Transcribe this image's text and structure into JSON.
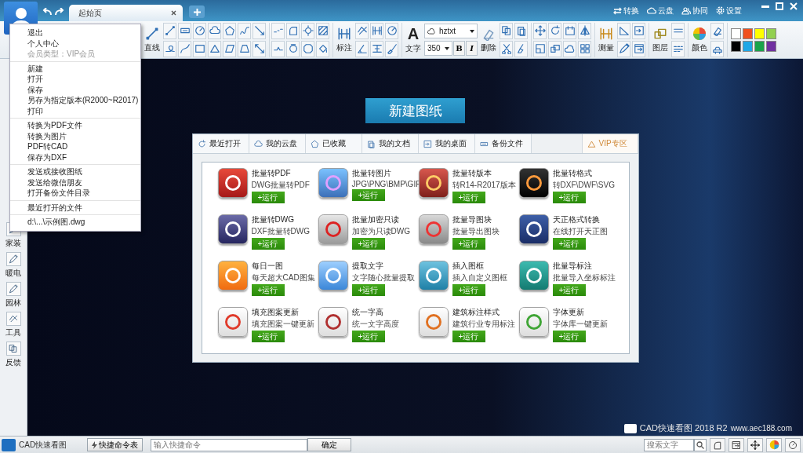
{
  "title_bar": {
    "tabs": [
      {
        "label": "起始页",
        "selected": true
      }
    ],
    "actions": [
      {
        "label": "转换"
      },
      {
        "label": "云盘"
      },
      {
        "label": "协同"
      },
      {
        "label": "设置"
      }
    ]
  },
  "toolbar": {
    "buttons": [
      {
        "label": "直线"
      },
      {
        "label": "标注"
      },
      {
        "label": "文字"
      },
      {
        "label": "删除"
      },
      {
        "label": "测量"
      },
      {
        "label": "图层"
      },
      {
        "label": "颜色"
      }
    ],
    "text_icon": "A",
    "font": {
      "value": "hztxt"
    },
    "size": {
      "value": "350"
    },
    "bold": "B",
    "italic": "I",
    "swatches": [
      {
        "color": "#ffffff"
      },
      {
        "color": "#f0501e"
      },
      {
        "color": "#ffff00"
      },
      {
        "color": "#92d050"
      },
      {
        "color": "#000000"
      },
      {
        "color": "#1fa8e6"
      },
      {
        "color": "#1aa34a"
      },
      {
        "color": "#7030a0"
      }
    ]
  },
  "user_menu": {
    "sections": [
      [
        {
          "label": "退出",
          "disabled": false
        },
        {
          "label": "个人中心",
          "disabled": false
        },
        {
          "label": "会员类型：VIP会员",
          "disabled": true
        }
      ],
      [
        {
          "label": "新建",
          "disabled": false
        },
        {
          "label": "打开",
          "disabled": false
        },
        {
          "label": "保存",
          "disabled": false
        },
        {
          "label": "另存为指定版本(R2000~R2017)",
          "disabled": false
        },
        {
          "label": "打印",
          "disabled": false
        }
      ],
      [
        {
          "label": "转换为PDF文件",
          "disabled": false
        },
        {
          "label": "转换为图片",
          "disabled": false
        },
        {
          "label": "PDF转CAD",
          "disabled": false
        },
        {
          "label": "保存为DXF",
          "disabled": false
        }
      ],
      [
        {
          "label": "发送或接收图纸",
          "disabled": false
        },
        {
          "label": "发送给微信朋友",
          "disabled": false
        },
        {
          "label": "打开备份文件目录",
          "disabled": false
        }
      ],
      [
        {
          "label": "最近打开的文件",
          "disabled": false
        }
      ],
      [
        {
          "label": "d:\\...\\示例图.dwg",
          "disabled": false
        }
      ]
    ]
  },
  "sidebar": {
    "items": [
      {
        "label": "家装"
      },
      {
        "label": "暖电"
      },
      {
        "label": "园林"
      },
      {
        "label": "工具"
      },
      {
        "label": "反馈"
      }
    ]
  },
  "canvas": {
    "new_drawing_button": "新建图纸",
    "tabs": [
      {
        "label": "最近打开",
        "selected": false
      },
      {
        "label": "我的云盘",
        "selected": false
      },
      {
        "label": "已收藏",
        "selected": false
      },
      {
        "label": "我的文档",
        "selected": false
      },
      {
        "label": "我的桌面",
        "selected": false
      },
      {
        "label": "备份文件",
        "selected": false
      },
      {
        "label": "VIP专区",
        "selected": true
      }
    ],
    "apps": [
      {
        "title": "批量转PDF",
        "subtitle": "DWG批量转PDF",
        "run": "+运行"
      },
      {
        "title": "批量转图片",
        "subtitle": "JPG\\PNG\\BMP\\GIF",
        "run": "+运行"
      },
      {
        "title": "批量转版本",
        "subtitle": "转R14-R2017版本",
        "run": "+运行"
      },
      {
        "title": "批量转格式",
        "subtitle": "转DXF\\DWF\\SVG",
        "run": "+运行"
      },
      {
        "title": "批量转DWG",
        "subtitle": "DXF批量转DWG",
        "run": "+运行"
      },
      {
        "title": "批量加密只读",
        "subtitle": "加密为只读DWG",
        "run": "+运行"
      },
      {
        "title": "批量导图块",
        "subtitle": "批量导出图块",
        "run": "+运行"
      },
      {
        "title": "天正格式转换",
        "subtitle": "在线打开天正图",
        "run": "+运行"
      },
      {
        "title": "每日一图",
        "subtitle": "每天超大CAD图集",
        "run": "+运行"
      },
      {
        "title": "提取文字",
        "subtitle": "文字随心批量提取",
        "run": "+运行"
      },
      {
        "title": "插入图框",
        "subtitle": "插入自定义图框",
        "run": "+运行"
      },
      {
        "title": "批量导标注",
        "subtitle": "批量导入坐标标注",
        "run": "+运行"
      },
      {
        "title": "填充图案更新",
        "subtitle": "填充图案一键更新",
        "run": "+运行"
      },
      {
        "title": "统一字高",
        "subtitle": "统一文字高度",
        "run": "+运行"
      },
      {
        "title": "建筑标注样式",
        "subtitle": "建筑行业专用标注",
        "run": "+运行"
      },
      {
        "title": "字体更新",
        "subtitle": "字体库一键更新",
        "run": "+运行"
      }
    ],
    "brand": {
      "name": "CAD快速看图 2018 R2",
      "url": "www.aec188.com"
    }
  },
  "status_bar": {
    "app_name": "CAD快速看图",
    "shortcut_button": "快捷命令表",
    "command": {
      "placeholder": "输入快捷命令"
    },
    "confirm_button": "确定",
    "search": {
      "placeholder": "搜索文字"
    }
  }
}
